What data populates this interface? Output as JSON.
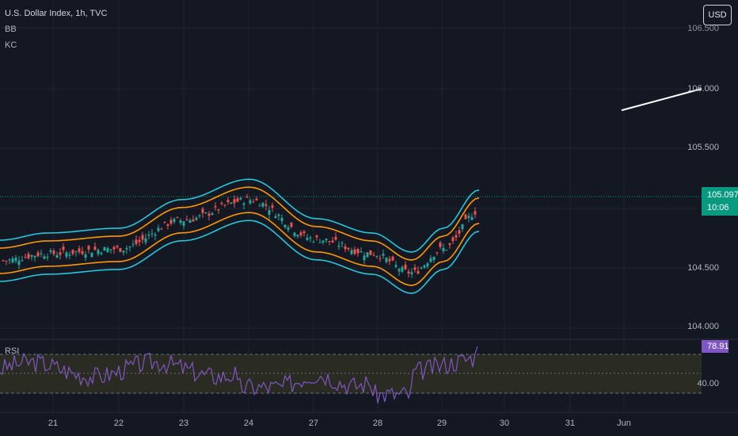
{
  "header": {
    "symbol_line": "U.S. Dollar Index, 1h, TVC",
    "indicator_1": "BB",
    "indicator_2": "KC",
    "currency_button": "USD"
  },
  "price_axis": {
    "ticks": [
      "106.000",
      "105.500",
      "104.500",
      "104.000"
    ],
    "partial_top_tick": "106.500"
  },
  "last_price": {
    "value": "105.097",
    "countdown": "10:06",
    "color": "#089981"
  },
  "rsi_panel": {
    "label": "RSI",
    "current_value": "78.91",
    "mid_tick": "40.00",
    "color": "#7e57c2"
  },
  "time_axis": {
    "labels": [
      "21",
      "22",
      "23",
      "24",
      "27",
      "28",
      "29",
      "30",
      "31",
      "Jun"
    ]
  },
  "colors": {
    "background": "#141823",
    "grid": "#1f2330",
    "candle_up": "#26a69a",
    "candle_down": "#ef5350",
    "bollinger": "#26c6da",
    "keltner": "#ff9800",
    "trend_line": "#ffffff",
    "rsi_band_fill": "#2e2f22"
  },
  "chart_data": [
    {
      "type": "line",
      "title": "U.S. Dollar Index, 1h, TVC",
      "ylim": [
        103.9,
        106.55
      ],
      "categories": [
        "21",
        "22",
        "23",
        "24",
        "27",
        "28",
        "29",
        "30",
        "31",
        "Jun"
      ],
      "series": [
        {
          "name": "BB",
          "values": [
            104.62,
            104.68,
            104.9,
            105.12,
            104.72,
            104.42,
            104.78,
            105.1
          ]
        },
        {
          "name": "KC",
          "values": [
            104.6,
            104.62,
            104.8,
            105.08,
            104.7,
            104.48,
            104.68,
            105.02
          ]
        }
      ],
      "last_price": 105.097,
      "trend_line": [
        105.82,
        106.0
      ]
    },
    {
      "type": "line",
      "title": "RSI",
      "ylim": [
        0,
        100
      ],
      "series": [
        {
          "name": "RSI",
          "values": [
            50,
            52,
            58,
            64,
            40,
            28,
            55,
            78.91
          ]
        }
      ],
      "last_value": 78.91
    }
  ]
}
